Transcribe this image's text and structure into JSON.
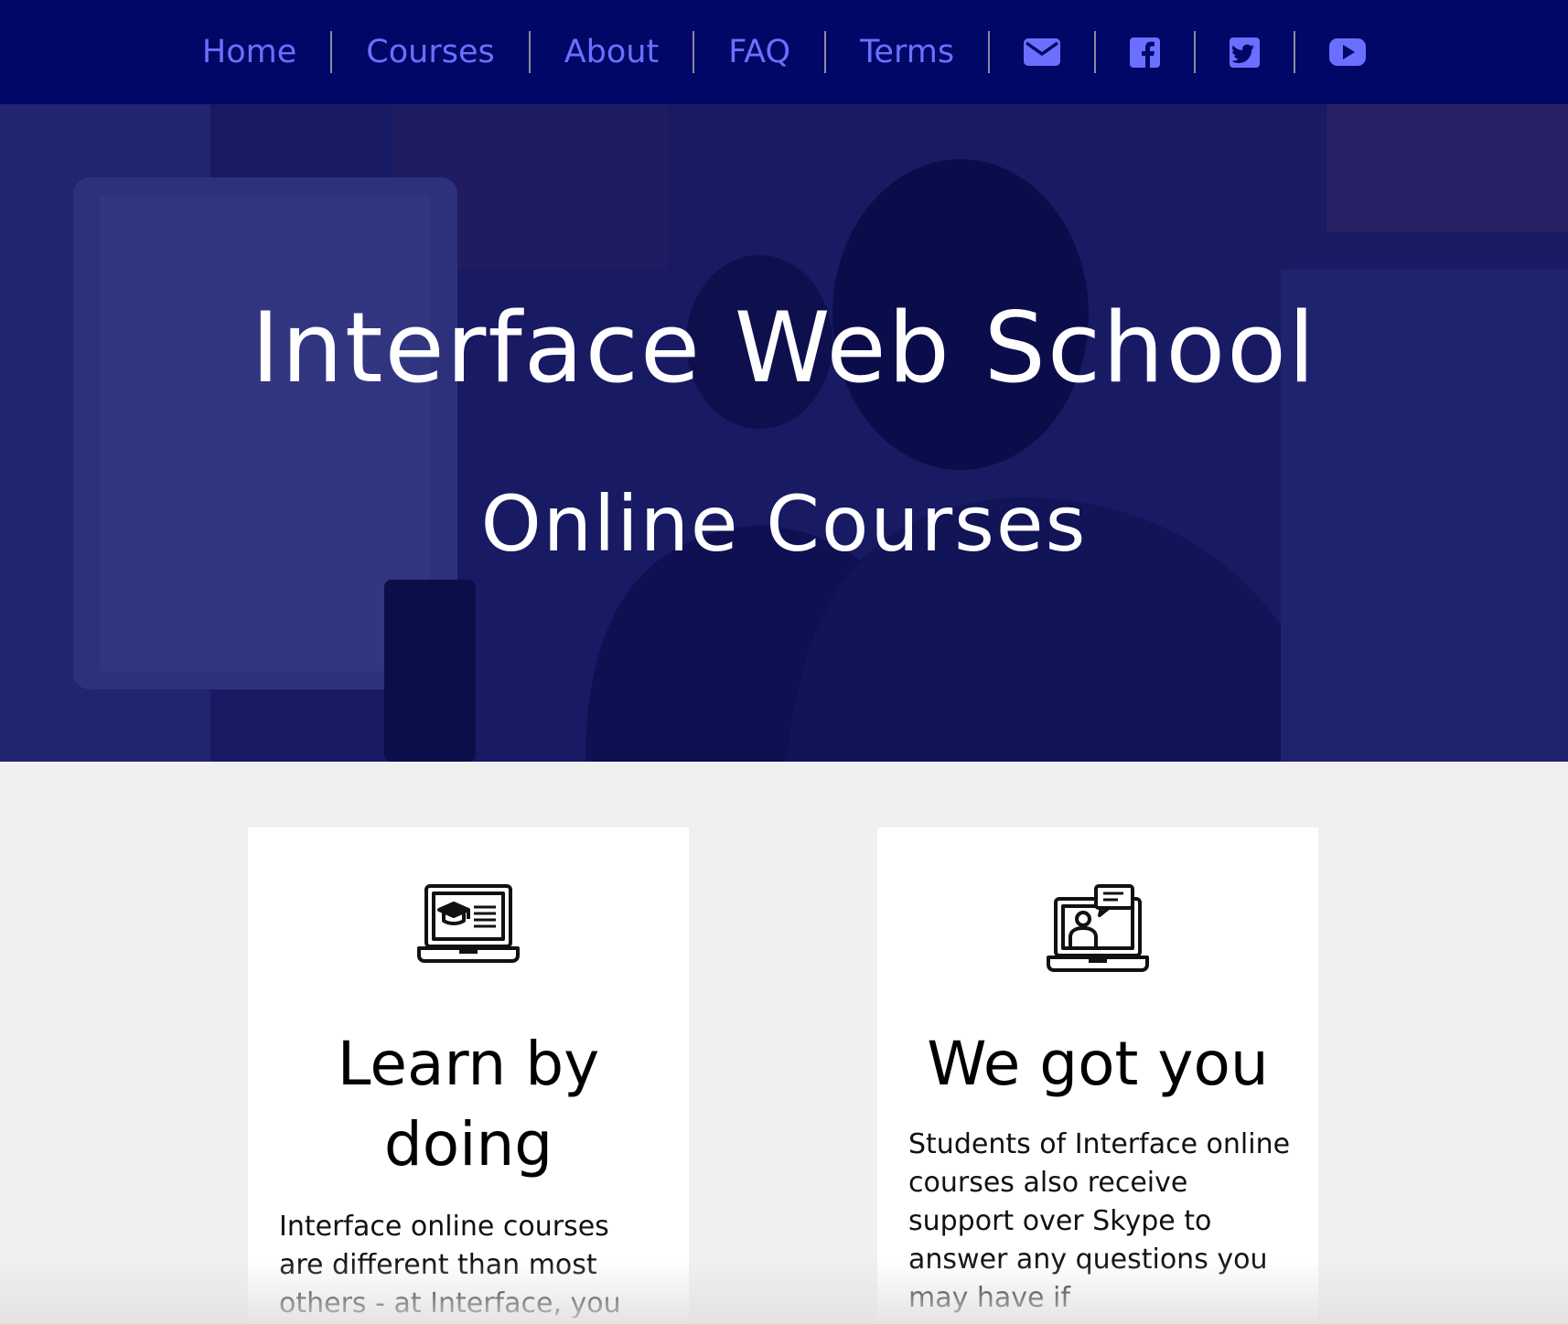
{
  "nav": {
    "items": [
      {
        "label": "Home"
      },
      {
        "label": "Courses"
      },
      {
        "label": "About"
      },
      {
        "label": "FAQ"
      },
      {
        "label": "Terms"
      }
    ],
    "icons": [
      "envelope-icon",
      "facebook-icon",
      "twitter-icon",
      "youtube-icon"
    ]
  },
  "hero": {
    "title": "Interface Web School",
    "subtitle": "Online Courses"
  },
  "cards": [
    {
      "icon": "laptop-graduation-icon",
      "title": "Learn by doing",
      "text": "Interface online courses are different than most others - at Interface, you"
    },
    {
      "icon": "laptop-video-chat-icon",
      "title": "We got you",
      "text": "Students of Interface online courses also receive support over Skype to answer any questions you may have if"
    }
  ],
  "colors": {
    "nav_bg": "#010766",
    "nav_link": "#6b6fff",
    "hero_overlay": "#1b1d63",
    "page_bg": "#f0f0f0",
    "card_bg": "#ffffff"
  }
}
